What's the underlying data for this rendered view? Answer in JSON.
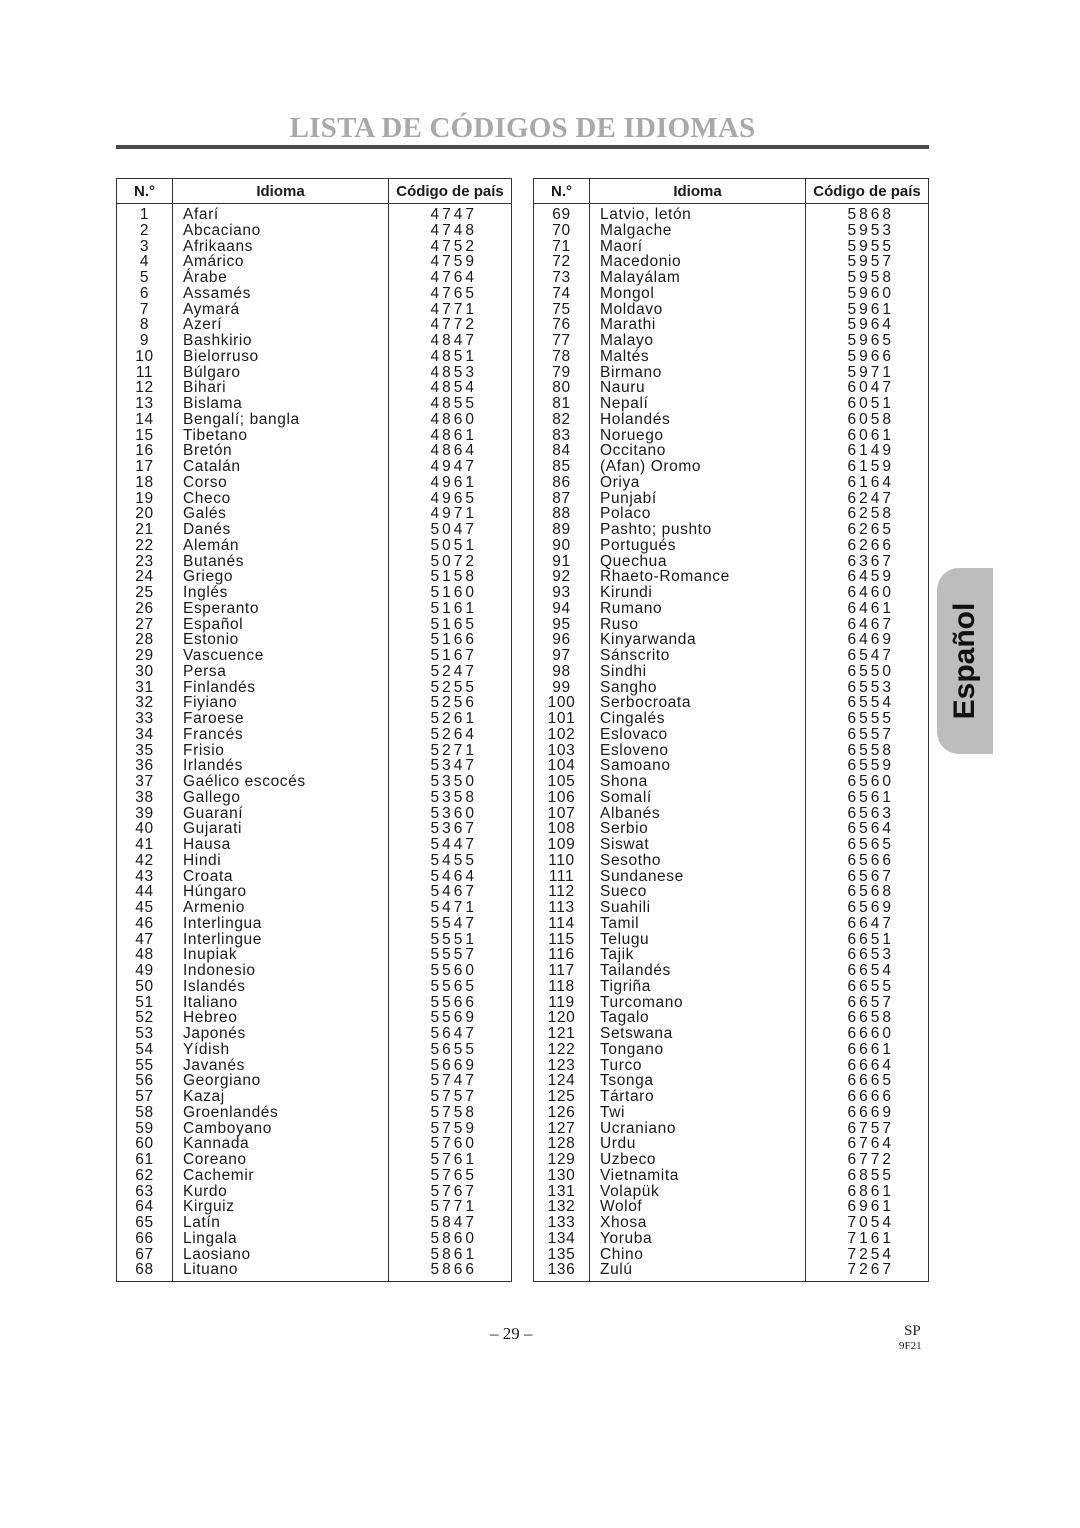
{
  "page": {
    "title": "LISTA DE CÓDIGOS DE IDIOMAS",
    "side_tab": "Español",
    "page_number": "– 29 –",
    "lang_code": "SP",
    "model_code": "9F21"
  },
  "table": {
    "headers": [
      "N.°",
      "Idioma",
      "Código de país"
    ],
    "left_rows": [
      [
        "1",
        "Afarí",
        "4747"
      ],
      [
        "2",
        "Abcaciano",
        "4748"
      ],
      [
        "3",
        "Afrikaans",
        "4752"
      ],
      [
        "4",
        "Amárico",
        "4759"
      ],
      [
        "5",
        "Árabe",
        "4764"
      ],
      [
        "6",
        "Assamés",
        "4765"
      ],
      [
        "7",
        "Aymará",
        "4771"
      ],
      [
        "8",
        "Azerí",
        "4772"
      ],
      [
        "9",
        "Bashkirio",
        "4847"
      ],
      [
        "10",
        "Bielorruso",
        "4851"
      ],
      [
        "11",
        "Búlgaro",
        "4853"
      ],
      [
        "12",
        "Bihari",
        "4854"
      ],
      [
        "13",
        "Bislama",
        "4855"
      ],
      [
        "14",
        "Bengalí; bangla",
        "4860"
      ],
      [
        "15",
        "Tibetano",
        "4861"
      ],
      [
        "16",
        "Bretón",
        "4864"
      ],
      [
        "17",
        "Catalán",
        "4947"
      ],
      [
        "18",
        "Corso",
        "4961"
      ],
      [
        "19",
        "Checo",
        "4965"
      ],
      [
        "20",
        "Galés",
        "4971"
      ],
      [
        "21",
        "Danés",
        "5047"
      ],
      [
        "22",
        "Alemán",
        "5051"
      ],
      [
        "23",
        "Butanés",
        "5072"
      ],
      [
        "24",
        "Griego",
        "5158"
      ],
      [
        "25",
        "Inglés",
        "5160"
      ],
      [
        "26",
        "Esperanto",
        "5161"
      ],
      [
        "27",
        "Español",
        "5165"
      ],
      [
        "28",
        "Estonio",
        "5166"
      ],
      [
        "29",
        "Vascuence",
        "5167"
      ],
      [
        "30",
        "Persa",
        "5247"
      ],
      [
        "31",
        "Finlandés",
        "5255"
      ],
      [
        "32",
        "Fiyiano",
        "5256"
      ],
      [
        "33",
        "Faroese",
        "5261"
      ],
      [
        "34",
        "Francés",
        "5264"
      ],
      [
        "35",
        "Frisio",
        "5271"
      ],
      [
        "36",
        "Irlandés",
        "5347"
      ],
      [
        "37",
        "Gaélico escocés",
        "5350"
      ],
      [
        "38",
        "Gallego",
        "5358"
      ],
      [
        "39",
        "Guaraní",
        "5360"
      ],
      [
        "40",
        "Gujarati",
        "5367"
      ],
      [
        "41",
        "Hausa",
        "5447"
      ],
      [
        "42",
        "Hindi",
        "5455"
      ],
      [
        "43",
        "Croata",
        "5464"
      ],
      [
        "44",
        "Húngaro",
        "5467"
      ],
      [
        "45",
        "Armenio",
        "5471"
      ],
      [
        "46",
        "Interlingua",
        "5547"
      ],
      [
        "47",
        "Interlingue",
        "5551"
      ],
      [
        "48",
        "Inupiak",
        "5557"
      ],
      [
        "49",
        "Indonesio",
        "5560"
      ],
      [
        "50",
        "Islandés",
        "5565"
      ],
      [
        "51",
        "Italiano",
        "5566"
      ],
      [
        "52",
        "Hebreo",
        "5569"
      ],
      [
        "53",
        "Japonés",
        "5647"
      ],
      [
        "54",
        "Yídish",
        "5655"
      ],
      [
        "55",
        "Javanés",
        "5669"
      ],
      [
        "56",
        "Georgiano",
        "5747"
      ],
      [
        "57",
        "Kazaj",
        "5757"
      ],
      [
        "58",
        "Groenlandés",
        "5758"
      ],
      [
        "59",
        "Camboyano",
        "5759"
      ],
      [
        "60",
        "Kannada",
        "5760"
      ],
      [
        "61",
        "Coreano",
        "5761"
      ],
      [
        "62",
        "Cachemir",
        "5765"
      ],
      [
        "63",
        "Kurdo",
        "5767"
      ],
      [
        "64",
        "Kirguiz",
        "5771"
      ],
      [
        "65",
        "Latín",
        "5847"
      ],
      [
        "66",
        "Lingala",
        "5860"
      ],
      [
        "67",
        "Laosiano",
        "5861"
      ],
      [
        "68",
        "Lituano",
        "5866"
      ]
    ],
    "right_rows": [
      [
        "69",
        "Latvio, letón",
        "5868"
      ],
      [
        "70",
        "Malgache",
        "5953"
      ],
      [
        "71",
        "Maorí",
        "5955"
      ],
      [
        "72",
        "Macedonio",
        "5957"
      ],
      [
        "73",
        "Malayálam",
        "5958"
      ],
      [
        "74",
        "Mongol",
        "5960"
      ],
      [
        "75",
        "Moldavo",
        "5961"
      ],
      [
        "76",
        "Marathi",
        "5964"
      ],
      [
        "77",
        "Malayo",
        "5965"
      ],
      [
        "78",
        "Maltés",
        "5966"
      ],
      [
        "79",
        "Birmano",
        "5971"
      ],
      [
        "80",
        "Nauru",
        "6047"
      ],
      [
        "81",
        "Nepalí",
        "6051"
      ],
      [
        "82",
        "Holandés",
        "6058"
      ],
      [
        "83",
        "Noruego",
        "6061"
      ],
      [
        "84",
        "Occitano",
        "6149"
      ],
      [
        "85",
        "(Afan) Oromo",
        "6159"
      ],
      [
        "86",
        "Oriya",
        "6164"
      ],
      [
        "87",
        "Punjabí",
        "6247"
      ],
      [
        "88",
        "Polaco",
        "6258"
      ],
      [
        "89",
        "Pashto; pushto",
        "6265"
      ],
      [
        "90",
        "Portugués",
        "6266"
      ],
      [
        "91",
        "Quechua",
        "6367"
      ],
      [
        "92",
        "Rhaeto-Romance",
        "6459"
      ],
      [
        "93",
        "Kirundi",
        "6460"
      ],
      [
        "94",
        "Rumano",
        "6461"
      ],
      [
        "95",
        "Ruso",
        "6467"
      ],
      [
        "96",
        "Kinyarwanda",
        "6469"
      ],
      [
        "97",
        "Sánscrito",
        "6547"
      ],
      [
        "98",
        "Sindhi",
        "6550"
      ],
      [
        "99",
        "Sangho",
        "6553"
      ],
      [
        "100",
        "Serbocroata",
        "6554"
      ],
      [
        "101",
        "Cingalés",
        "6555"
      ],
      [
        "102",
        "Eslovaco",
        "6557"
      ],
      [
        "103",
        "Esloveno",
        "6558"
      ],
      [
        "104",
        "Samoano",
        "6559"
      ],
      [
        "105",
        "Shona",
        "6560"
      ],
      [
        "106",
        "Somalí",
        "6561"
      ],
      [
        "107",
        "Albanés",
        "6563"
      ],
      [
        "108",
        "Serbio",
        "6564"
      ],
      [
        "109",
        "Siswat",
        "6565"
      ],
      [
        "110",
        "Sesotho",
        "6566"
      ],
      [
        "111",
        "Sundanese",
        "6567"
      ],
      [
        "112",
        "Sueco",
        "6568"
      ],
      [
        "113",
        "Suahili",
        "6569"
      ],
      [
        "114",
        "Tamil",
        "6647"
      ],
      [
        "115",
        "Telugu",
        "6651"
      ],
      [
        "116",
        "Tajik",
        "6653"
      ],
      [
        "117",
        "Tailandés",
        "6654"
      ],
      [
        "118",
        "Tigriña",
        "6655"
      ],
      [
        "119",
        "Turcomano",
        "6657"
      ],
      [
        "120",
        "Tagalo",
        "6658"
      ],
      [
        "121",
        "Setswana",
        "6660"
      ],
      [
        "122",
        "Tongano",
        "6661"
      ],
      [
        "123",
        "Turco",
        "6664"
      ],
      [
        "124",
        "Tsonga",
        "6665"
      ],
      [
        "125",
        "Tártaro",
        "6666"
      ],
      [
        "126",
        "Twi",
        "6669"
      ],
      [
        "127",
        "Ucraniano",
        "6757"
      ],
      [
        "128",
        "Urdu",
        "6764"
      ],
      [
        "129",
        "Uzbeco",
        "6772"
      ],
      [
        "130",
        "Vietnamita",
        "6855"
      ],
      [
        "131",
        "Volapük",
        "6861"
      ],
      [
        "132",
        "Wolof",
        "6961"
      ],
      [
        "133",
        "Xhosa",
        "7054"
      ],
      [
        "134",
        "Yoruba",
        "7161"
      ],
      [
        "135",
        "Chino",
        "7254"
      ],
      [
        "136",
        "Zulú",
        "7267"
      ]
    ]
  }
}
